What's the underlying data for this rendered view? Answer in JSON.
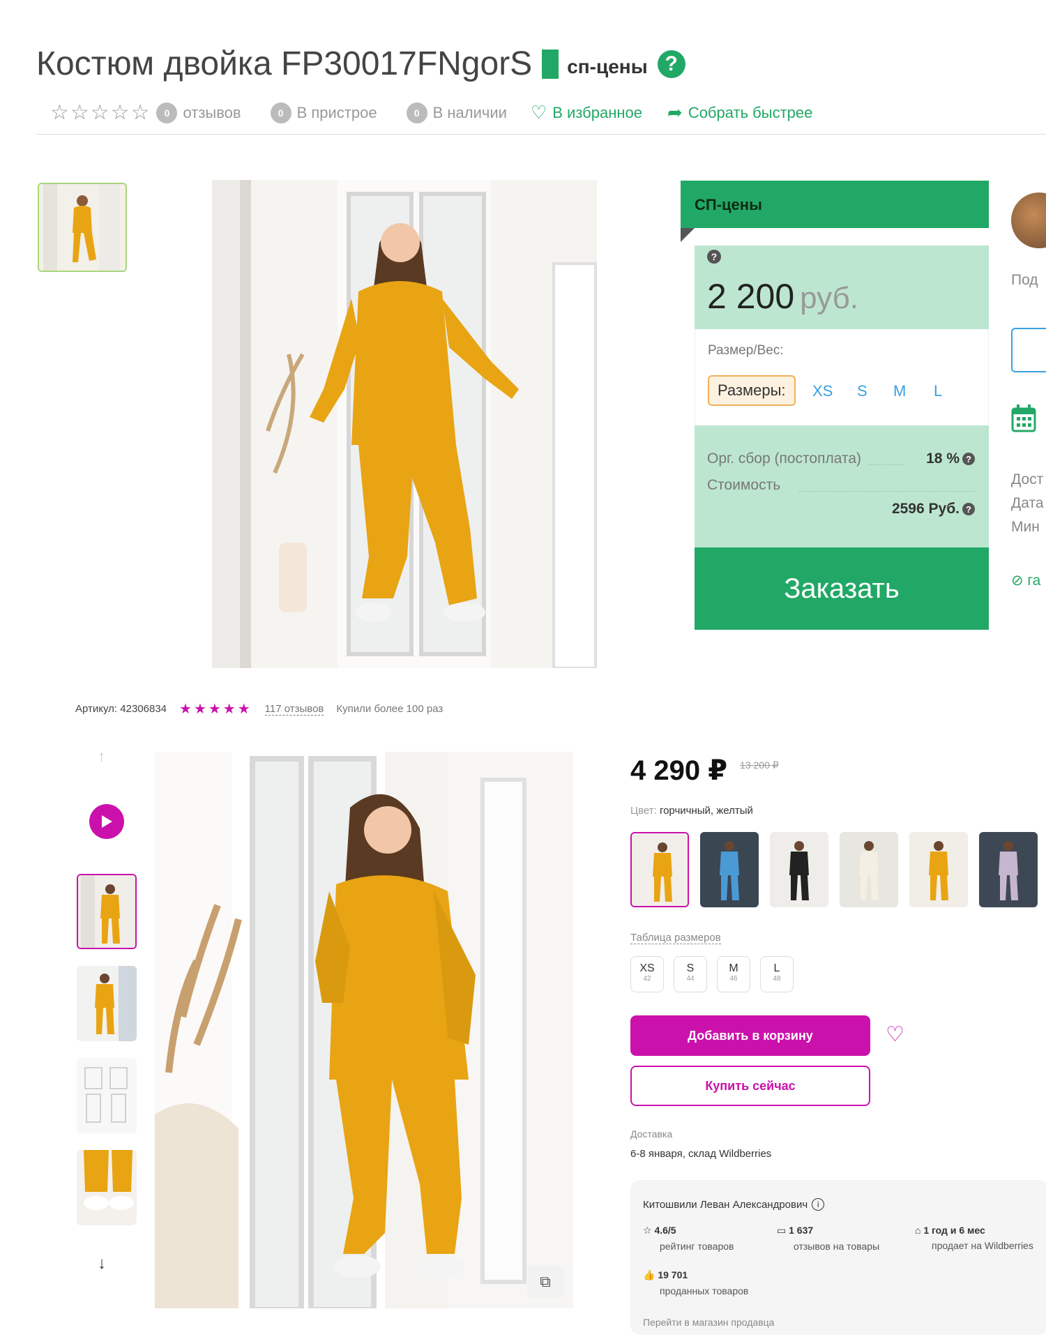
{
  "product": {
    "title": "Костюм двойка FP30017FNgorS",
    "sp_label": "сп-цены",
    "help_glyph": "?",
    "rating_stars": "☆☆☆☆☆",
    "reviews_count": "0",
    "reviews_label": "отзывов",
    "in_build_count": "0",
    "in_build_label": "В пристрое",
    "in_stock_count": "0",
    "in_stock_label": "В наличии",
    "favorite_label": "В избранное",
    "collect_label": "Собрать быстрее"
  },
  "price_card": {
    "header": "СП-цены",
    "price": "2 200",
    "currency": "руб.",
    "size_weight_label": "Размер/Вес:",
    "sizes_button": "Размеры:",
    "sizes": [
      "XS",
      "S",
      "M",
      "L"
    ],
    "org_fee_label": "Орг. сбор (постоплата)",
    "org_fee_value": "18 %",
    "cost_label": "Стоимость",
    "cost_value": "2596 Руб.",
    "order_button": "Заказать"
  },
  "right_edge": {
    "text1": "Под",
    "text2": "Дост",
    "text3": "Дата",
    "text4": "Мин",
    "green_text": "⊘ га"
  },
  "wb": {
    "article_label": "Артикул:",
    "article": "42306834",
    "stars": "★★★★★",
    "reviews": "117 отзывов",
    "bought": "Купили более 100 раз",
    "price": "4 290 ₽",
    "old_price": "13 200 ₽",
    "color_label": "Цвет:",
    "color_value": "горчичный, желтый",
    "size_table": "Таблица размеров",
    "sizes": [
      {
        "s": "XS",
        "n": "42"
      },
      {
        "s": "S",
        "n": "44"
      },
      {
        "s": "M",
        "n": "46"
      },
      {
        "s": "L",
        "n": "48"
      }
    ],
    "cart_button": "Добавить в корзину",
    "buy_button": "Купить сейчас",
    "delivery_label": "Доставка",
    "delivery_value": "6-8 января, склад Wildberries",
    "seller_name": "Китошвили Леван Александрович",
    "seller_rating": "4.6/5",
    "seller_rating_label": "рейтинг товаров",
    "seller_reviews": "1 637",
    "seller_reviews_label": "отзывов на товары",
    "seller_age": "1 год и 6 мес",
    "seller_age_label": "продает на Wildberries",
    "seller_sold": "19 701",
    "seller_sold_label": "проданных товаров",
    "seller_link": "Перейти в магазин продавца"
  },
  "colors": {
    "sp_green": "#22a866",
    "sp_light_green": "#bde6d0",
    "wb_magenta": "#cb11ab",
    "mustard": "#e8a413"
  }
}
